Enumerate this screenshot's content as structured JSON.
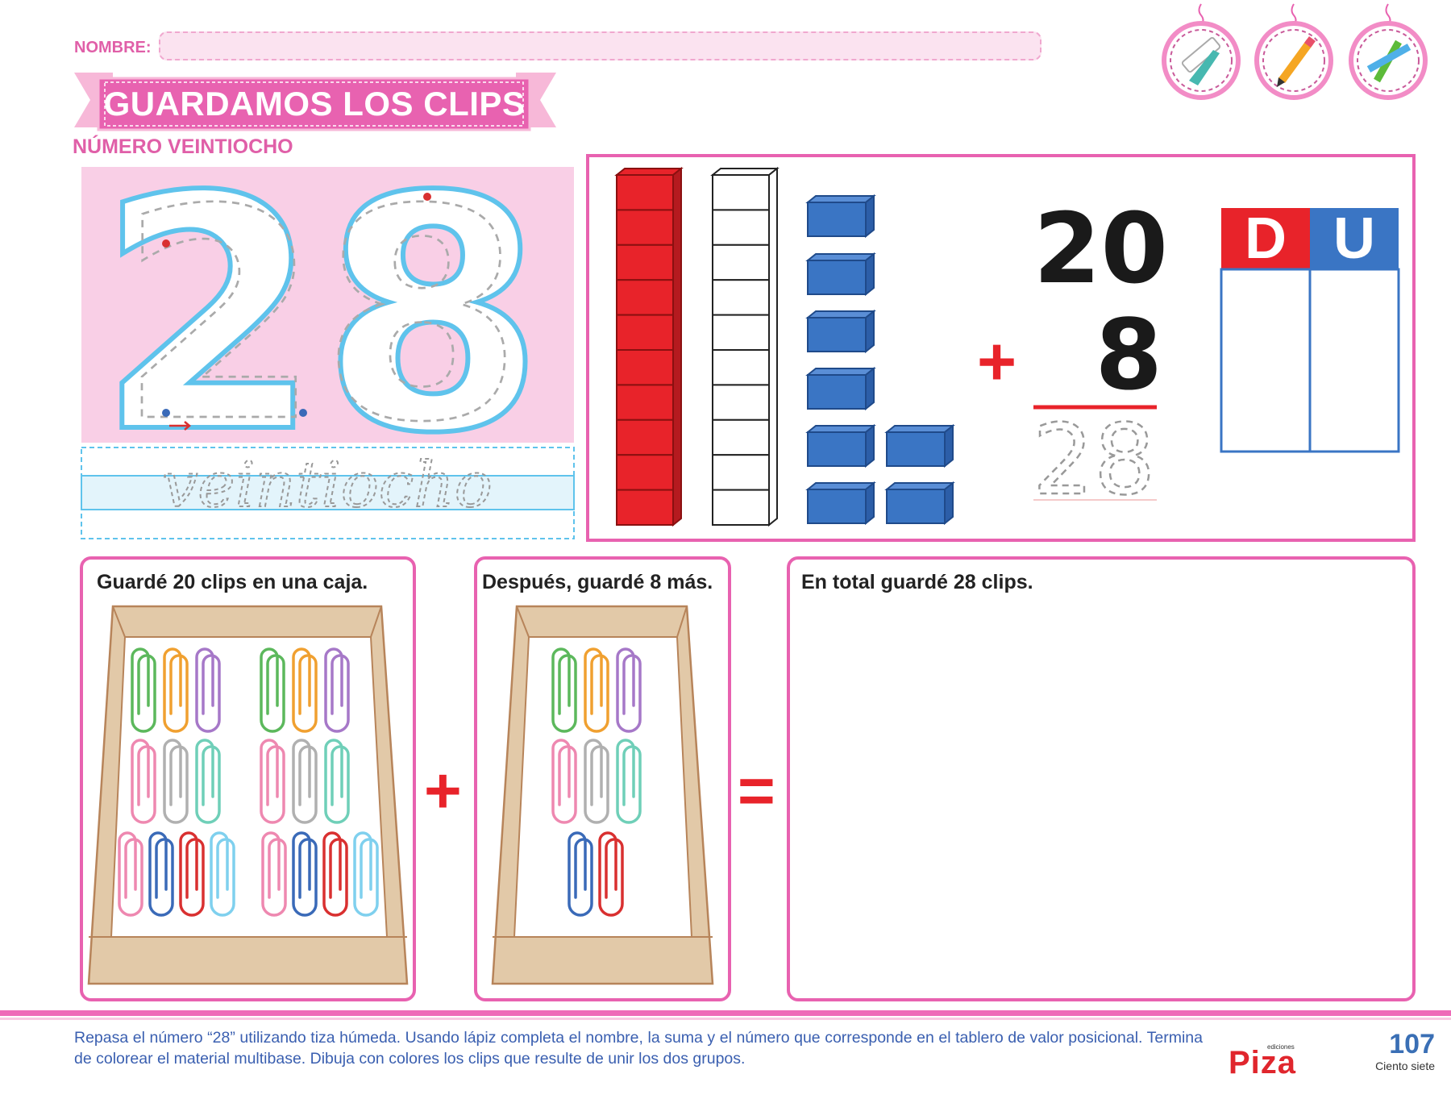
{
  "header": {
    "name_label": "NOMBRE:",
    "name_value": "",
    "title": "GUARDAMOS LOS CLIPS",
    "subtitle": "NÚMERO VEINTIOCHO",
    "tool_icons": [
      "chalk-icon",
      "pencil-icon",
      "colored-pencils-icon"
    ]
  },
  "tracing": {
    "number": "28",
    "word": "veintiocho"
  },
  "base_ten": {
    "tens_rods": 2,
    "units_cubes": 8,
    "tens_colors": [
      "#e8232a",
      "#ffffff"
    ],
    "unit_color": "#3a75c4"
  },
  "sum": {
    "addend1": "20",
    "operator": "+",
    "addend2": "8",
    "result_trace": "28"
  },
  "place_value": {
    "tens_label": "D",
    "units_label": "U",
    "tens_color": "#e8232a",
    "units_color": "#3a75c4"
  },
  "problem": {
    "box1_caption": "Guardé 20 clips en una caja.",
    "plus": "+",
    "box2_caption": "Después, guardé 8 más.",
    "equals": "=",
    "box3_caption": "En total guardé 28 clips.",
    "box1_clips": 20,
    "box2_clips": 8,
    "clip_colors": {
      "green": "#5cb85c",
      "orange": "#f0a030",
      "purple": "#a678c8",
      "pink": "#ee88b0",
      "gray": "#b0b0b0",
      "teal": "#6fcfb8",
      "blue": "#3a6ab8",
      "red": "#d93030",
      "lightblue": "#7fd0ee"
    }
  },
  "footer": {
    "instructions": "Repasa el número “28” utilizando tiza húmeda. Usando lápiz completa el nombre, la suma y el número que corresponde en el tablero de valor posicional. Termina de colorear el material multibase. Dibuja con colores los clips que resulte de unir los dos grupos.",
    "publisher_small": "ediciones",
    "publisher": "Piza",
    "page_number": "107",
    "page_words": "Ciento siete"
  },
  "colors": {
    "accent_pink": "#e862b0",
    "text_blue": "#3a5fb0",
    "red": "#e8232a"
  }
}
